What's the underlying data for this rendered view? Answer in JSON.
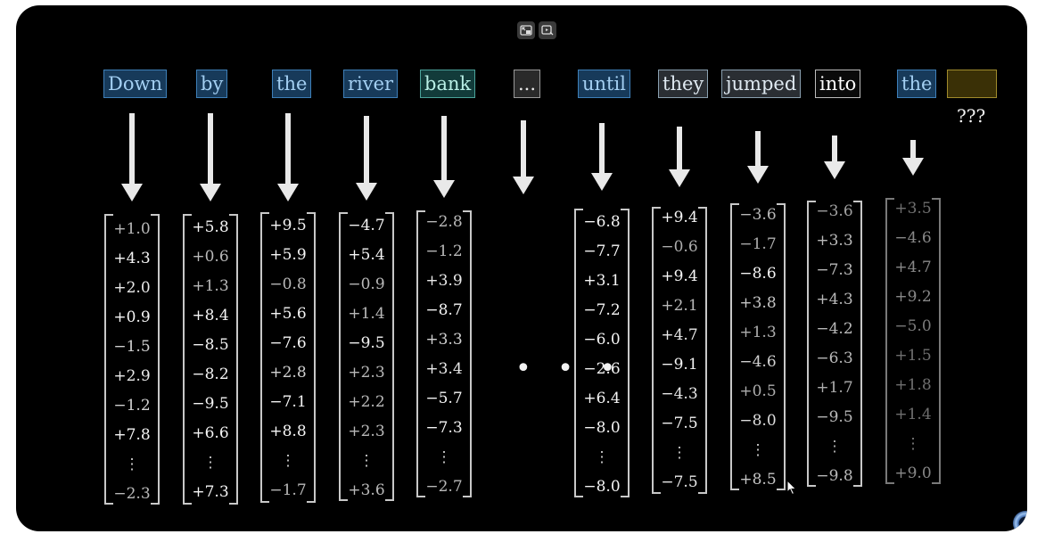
{
  "toolbar": {
    "controls": [
      {
        "icon": "exit-pip-icon"
      },
      {
        "icon": "screen-share-icon"
      }
    ]
  },
  "tokens": [
    {
      "label": "Down",
      "style": "blue"
    },
    {
      "label": "by",
      "style": "blue"
    },
    {
      "label": "the",
      "style": "blue"
    },
    {
      "label": "river",
      "style": "blue"
    },
    {
      "label": "bank",
      "style": "teal"
    },
    {
      "label": "...",
      "style": "gray"
    },
    {
      "label": "until",
      "style": "blue"
    },
    {
      "label": "they",
      "style": "slate"
    },
    {
      "label": "jumped",
      "style": "slate"
    },
    {
      "label": "into",
      "style": "white"
    },
    {
      "label": "the",
      "style": "blue"
    },
    {
      "label": "",
      "style": "empty"
    }
  ],
  "unknown_label": "???",
  "ellipsis_label": "• • •",
  "vectors": [
    {
      "values": [
        "+1.0",
        "+4.3",
        "+2.0",
        "+0.9",
        "−1.5",
        "+2.9",
        "−1.2",
        "+7.8",
        "⋮",
        "−2.3"
      ]
    },
    {
      "values": [
        "+5.8",
        "+0.6",
        "+1.3",
        "+8.4",
        "−8.5",
        "−8.2",
        "−9.5",
        "+6.6",
        "⋮",
        "+7.3"
      ]
    },
    {
      "values": [
        "+9.5",
        "+5.9",
        "−0.8",
        "+5.6",
        "−7.6",
        "+2.8",
        "−7.1",
        "+8.8",
        "⋮",
        "−1.7"
      ]
    },
    {
      "values": [
        "−4.7",
        "+5.4",
        "−0.9",
        "+1.4",
        "−9.5",
        "+2.3",
        "+2.2",
        "+2.3",
        "⋮",
        "+3.6"
      ]
    },
    {
      "values": [
        "−2.8",
        "−1.2",
        "+3.9",
        "−8.7",
        "+3.3",
        "+3.4",
        "−5.7",
        "−7.3",
        "⋮",
        "−2.7"
      ]
    },
    {
      "values": [
        "−6.8",
        "−7.7",
        "+3.1",
        "−7.2",
        "−6.0",
        "−2.6",
        "+6.4",
        "−8.0",
        "⋮",
        "−8.0"
      ]
    },
    {
      "values": [
        "+9.4",
        "−0.6",
        "+9.4",
        "+2.1",
        "+4.7",
        "−9.1",
        "−4.3",
        "−7.5",
        "⋮",
        "−7.5"
      ]
    },
    {
      "values": [
        "−3.6",
        "−1.7",
        "−8.6",
        "+3.8",
        "+1.3",
        "−4.6",
        "+0.5",
        "−8.0",
        "⋮",
        "+8.5"
      ]
    },
    {
      "values": [
        "−3.6",
        "+3.3",
        "−7.3",
        "+4.3",
        "−4.2",
        "−6.3",
        "+1.7",
        "−9.5",
        "⋮",
        "−9.8"
      ]
    },
    {
      "values": [
        "+3.5",
        "−4.6",
        "+4.7",
        "+9.2",
        "−5.0",
        "+1.5",
        "+1.8",
        "+1.4",
        "⋮",
        "+9.0"
      ]
    }
  ]
}
